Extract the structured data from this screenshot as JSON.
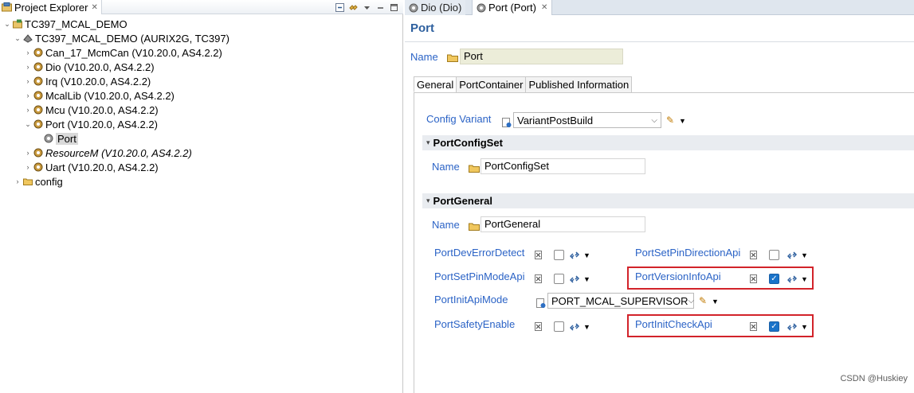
{
  "left_panel": {
    "view_title": "Project Explorer",
    "tree": [
      {
        "label": "TC397_MCAL_DEMO",
        "twisty": "expanded"
      },
      {
        "label": "TC397_MCAL_DEMO (AURIX2G, TC397)",
        "twisty": "expanded"
      },
      {
        "label": "Can_17_McmCan (V10.20.0, AS4.2.2)",
        "twisty": "collapsed"
      },
      {
        "label": "Dio (V10.20.0, AS4.2.2)",
        "twisty": "collapsed"
      },
      {
        "label": "Irq (V10.20.0, AS4.2.2)",
        "twisty": "collapsed"
      },
      {
        "label": "McalLib (V10.20.0, AS4.2.2)",
        "twisty": "collapsed"
      },
      {
        "label": "Mcu (V10.20.0, AS4.2.2)",
        "twisty": "collapsed"
      },
      {
        "label": "Port (V10.20.0, AS4.2.2)",
        "twisty": "expanded"
      },
      {
        "label": "Port",
        "twisty": "none",
        "selected": true
      },
      {
        "label": "ResourceM (V10.20.0, AS4.2.2)",
        "twisty": "collapsed",
        "italic": true
      },
      {
        "label": "Uart (V10.20.0, AS4.2.2)",
        "twisty": "collapsed"
      },
      {
        "label": "config",
        "twisty": "collapsed"
      }
    ]
  },
  "editor": {
    "tabs": [
      {
        "label": "Dio (Dio)",
        "active": false
      },
      {
        "label": "Port (Port)",
        "active": true
      }
    ],
    "page_title": "Port",
    "name_label": "Name",
    "name_value": "Port",
    "inner_tabs": [
      "General",
      "PortContainer",
      "Published Information"
    ],
    "config_variant": {
      "label": "Config Variant",
      "value": "VariantPostBuild"
    },
    "port_config_set": {
      "header": "PortConfigSet",
      "name_label": "Name",
      "name_value": "PortConfigSet"
    },
    "port_general": {
      "header": "PortGeneral",
      "name_label": "Name",
      "name_value": "PortGeneral",
      "params": {
        "dev_error_detect": {
          "label": "PortDevErrorDetect",
          "checked": false
        },
        "set_pin_direction_api": {
          "label": "PortSetPinDirectionApi",
          "checked": false
        },
        "set_pin_mode_api": {
          "label": "PortSetPinModeApi",
          "checked": false
        },
        "version_info_api": {
          "label": "PortVersionInfoApi",
          "checked": true,
          "highlighted": true
        },
        "init_api_mode": {
          "label": "PortInitApiMode",
          "value": "PORT_MCAL_SUPERVISOR"
        },
        "safety_enable": {
          "label": "PortSafetyEnable",
          "checked": false
        },
        "init_check_api": {
          "label": "PortInitCheckApi",
          "checked": true,
          "highlighted": true
        }
      }
    },
    "highlight_color": "#d2232a",
    "accent_color": "#2b63c6"
  },
  "watermark": "CSDN @Huskiey"
}
